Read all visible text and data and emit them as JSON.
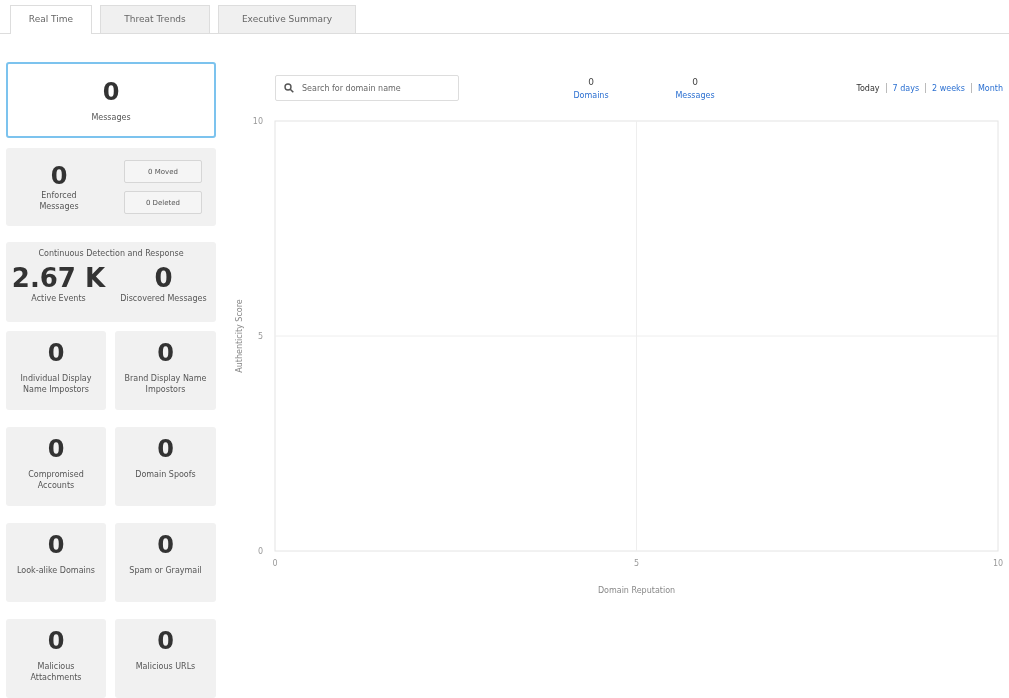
{
  "tabs": [
    {
      "label": "Real Time",
      "selected": true
    },
    {
      "label": "Threat Trends",
      "selected": false
    },
    {
      "label": "Executive Summary",
      "selected": false
    }
  ],
  "summary": {
    "value": "0",
    "label": "Messages",
    "selected": true
  },
  "enforced": {
    "value": "0",
    "label": "Enforced Messages",
    "buttons": [
      "0 Moved",
      "0 Deleted"
    ]
  },
  "cdr": {
    "title": "Continuous Detection and Response",
    "metrics": [
      {
        "value": "2.67 K",
        "label": "Active Events"
      },
      {
        "value": "0",
        "label": "Discovered Messages"
      }
    ]
  },
  "tiles": [
    {
      "value": "0",
      "label": "Individual Display Name Impostors"
    },
    {
      "value": "0",
      "label": "Brand Display Name Impostors"
    },
    {
      "value": "0",
      "label": "Compromised Accounts"
    },
    {
      "value": "0",
      "label": "Domain Spoofs"
    },
    {
      "value": "0",
      "label": "Look-alike Domains"
    },
    {
      "value": "0",
      "label": "Spam or Graymail"
    },
    {
      "value": "0",
      "label": "Malicious Attachments"
    },
    {
      "value": "0",
      "label": "Malicious URLs"
    }
  ],
  "search": {
    "placeholder": "Search for domain name"
  },
  "counts": [
    {
      "value": "0",
      "label": "Domains"
    },
    {
      "value": "0",
      "label": "Messages"
    }
  ],
  "ranges": [
    {
      "label": "Today",
      "selected": true
    },
    {
      "label": "7 days",
      "selected": false
    },
    {
      "label": "2 weeks",
      "selected": false
    },
    {
      "label": "Month",
      "selected": false
    }
  ],
  "chart": {
    "chart_data": {
      "type": "scatter",
      "xlabel": "Domain Reputation",
      "ylabel": "Authenticity Score",
      "xlim": [
        0,
        10
      ],
      "ylim": [
        0,
        10
      ],
      "xticks": [
        0,
        5,
        10
      ],
      "yticks": [
        0,
        5,
        10
      ]
    }
  }
}
